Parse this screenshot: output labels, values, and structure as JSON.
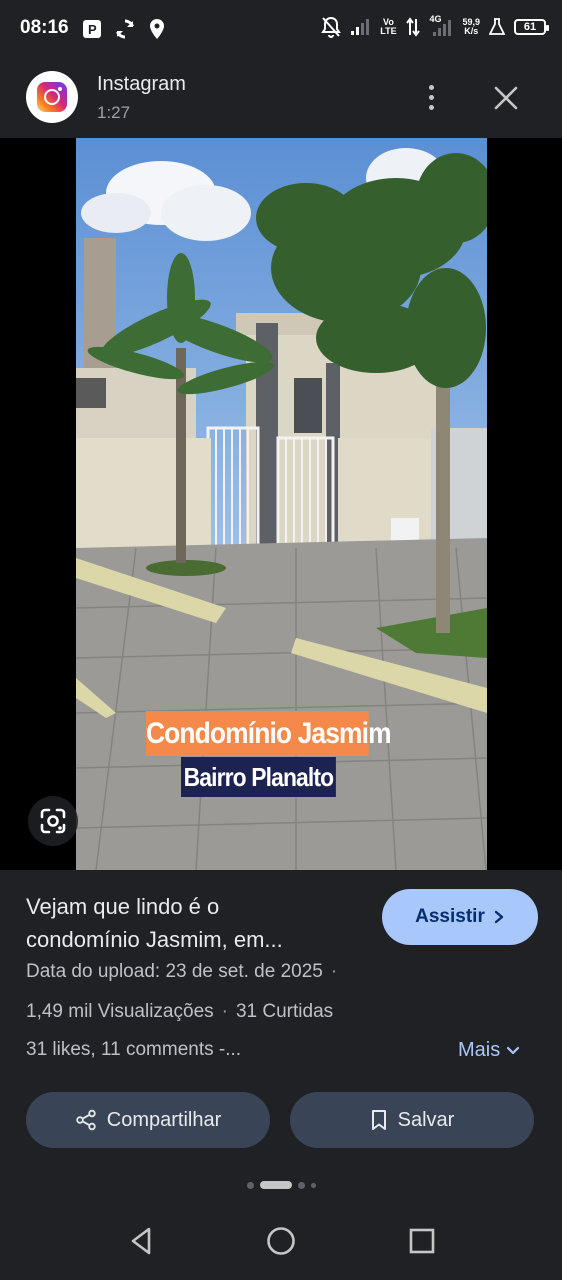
{
  "status_bar": {
    "time": "08:16",
    "network_speed": "59,9",
    "speed_unit": "K/s",
    "network_type": "4G",
    "volte": "Vo LTE",
    "battery": "61"
  },
  "header": {
    "source_name": "Instagram",
    "duration": "1:27",
    "source_icon": "instagram-logo-icon",
    "more_icon": "more-vertical-icon",
    "close_icon": "close-icon"
  },
  "media": {
    "overlay_title": "Condomínio Jasmim",
    "overlay_subtitle": "Bairro Planalto",
    "overlay_title_color": "#f5894a",
    "overlay_subtitle_color": "#1d2350",
    "lens_icon": "google-lens-icon"
  },
  "info": {
    "title_line1": "Vejam que lindo é o",
    "title_line2": "condomínio Jasmim, em...",
    "watch_label": "Assistir",
    "upload_date": "Data do upload: 23 de set. de 2025",
    "views": "1,49 mil Visualizações",
    "likes": "31 Curtidas",
    "description": "31 likes, 11 comments -...",
    "more_label": "Mais",
    "share_label": "Compartilhar",
    "save_label": "Salvar",
    "accent_color": "#a8c7fa"
  },
  "nav": {
    "back_icon": "back-triangle-icon",
    "home_icon": "home-circle-icon",
    "recents_icon": "recents-square-icon"
  }
}
